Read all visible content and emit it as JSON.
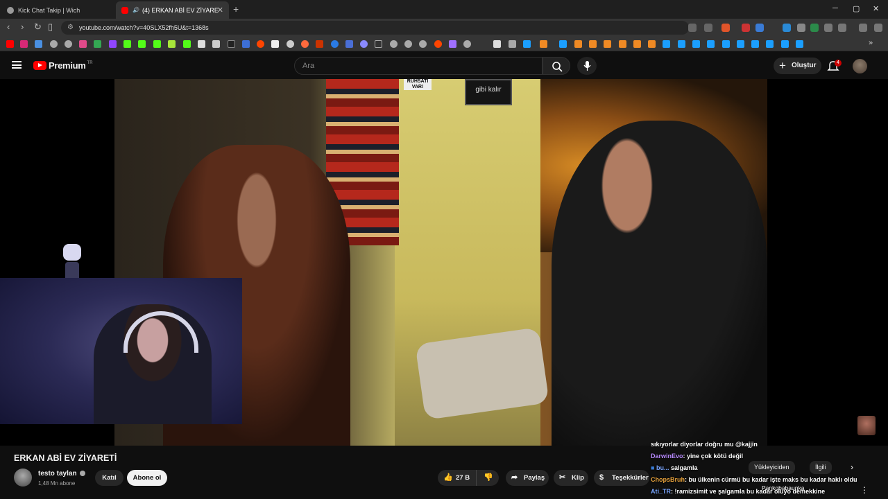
{
  "browser": {
    "tabs": [
      {
        "title": "Kick Chat Takip | Wich",
        "active": false
      },
      {
        "title": "(4) ERKAN ABİ EV ZİYARETİ -",
        "active": true
      }
    ],
    "new_tab": "+",
    "url": "youtube.com/watch?v=40SLX52fh5U&t=1368s",
    "window_controls": [
      "─",
      "▢",
      "✕"
    ]
  },
  "header": {
    "logo_text": "Premium",
    "logo_country": "TR",
    "search_placeholder": "Ara",
    "create_label": "Oluştur",
    "notifications_count": "4"
  },
  "player": {
    "sign_left": "RUHSATI VAR!",
    "sign_right": "gibi kalır"
  },
  "video": {
    "title": "ERKAN ABİ EV ZİYARETİ",
    "channel_name": "testo taylan",
    "subscribers": "1,48 Mn abone",
    "join_label": "Katıl",
    "subscribe_label": "Abone ol",
    "likes": "27 B",
    "share_label": "Paylaş",
    "clip_label": "Klip",
    "thanks_label": "Teşekkürler"
  },
  "chips": {
    "uploader_chip": "Yükleyiciden",
    "related_chip": "İlgili"
  },
  "chat": {
    "lines": [
      {
        "user": "",
        "text": "sıkıyorlar diyorlar doğru mu @kajjin"
      },
      {
        "user": "DarwinEvo",
        "text": ": yine çok kötü değil"
      },
      {
        "user": "bu...",
        "text": "salgamla"
      },
      {
        "user": "ChopsBruh",
        "text": ": bu ülkenin cürmü bu kadar işte maks bu kadar haklı oldu"
      },
      {
        "user": "Ati_TR",
        "text": ": !ramizsimit ve şalgamla bu kadar oluyo demekkine"
      }
    ],
    "overlay_name": "Pankobabaunka"
  }
}
